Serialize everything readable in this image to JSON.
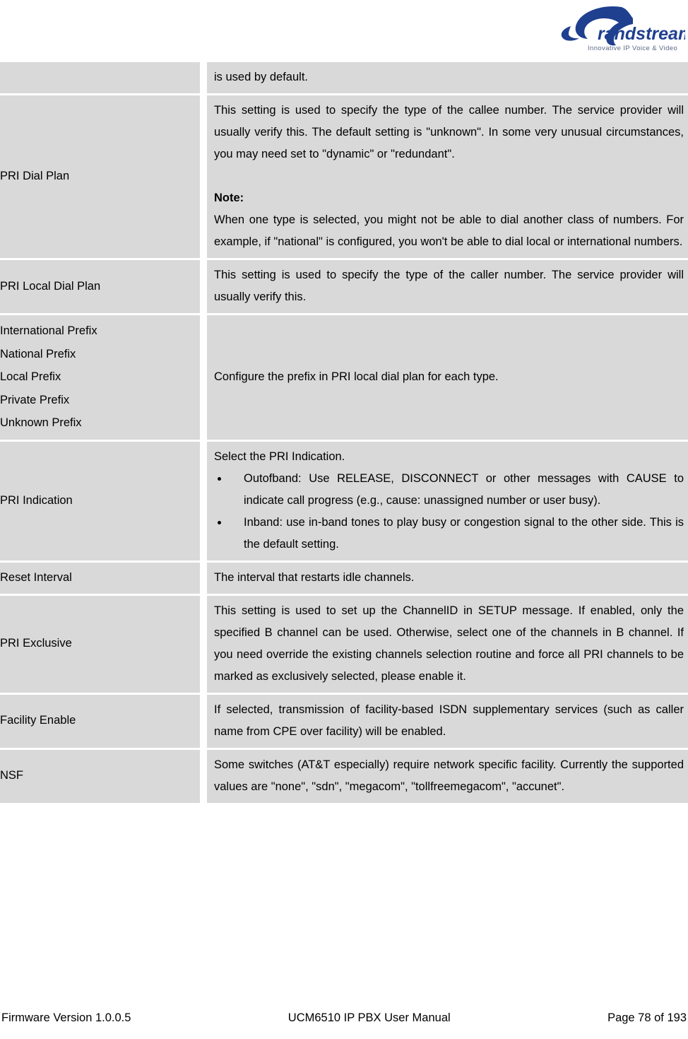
{
  "brand": {
    "logo_name": "grandstream-logo",
    "wordmark": "randstream",
    "tagline": "Innovative IP Voice & Video",
    "logo_color": "#1f3f8f"
  },
  "colors": {
    "cell_background": "#d9d9d9",
    "page_background": "#ffffff",
    "text": "#000000"
  },
  "table": {
    "rows": [
      {
        "label": "",
        "paragraphs": [
          {
            "type": "text",
            "text": "is used by default."
          }
        ]
      },
      {
        "label": "PRI Dial Plan",
        "paragraphs": [
          {
            "type": "text",
            "text": "This setting is used to specify the type of the callee number. The service provider will usually verify this. The default setting is \"unknown\". In some very unusual circumstances, you may need set to \"dynamic\" or \"redundant\"."
          },
          {
            "type": "blank",
            "text": ""
          },
          {
            "type": "note-head",
            "text": "Note:"
          },
          {
            "type": "text",
            "text": "When one type is selected, you might not be able to dial another class of numbers. For example, if \"national\" is configured, you won't be able to dial local or international numbers."
          }
        ]
      },
      {
        "label": "PRI Local Dial Plan",
        "paragraphs": [
          {
            "type": "text",
            "text": "This setting is used to specify the type of the caller number. The service provider will usually verify this."
          }
        ]
      },
      {
        "label_list": [
          "International Prefix",
          "National Prefix",
          "Local Prefix",
          "Private Prefix",
          "Unknown Prefix"
        ],
        "paragraphs": [
          {
            "type": "text-left",
            "text": "Configure the prefix in PRI local dial plan for each type."
          }
        ]
      },
      {
        "label": "PRI Indication",
        "paragraphs": [
          {
            "type": "text-left",
            "text": "Select the PRI Indication."
          },
          {
            "type": "bullets",
            "items": [
              "Outofband: Use RELEASE, DISCONNECT or other messages with CAUSE to indicate call progress (e.g., cause: unassigned number or user busy).",
              "Inband: use in-band tones to play busy or congestion signal to the other side. This is the default setting."
            ]
          }
        ]
      },
      {
        "label": "Reset Interval",
        "paragraphs": [
          {
            "type": "text-left",
            "text": "The interval that restarts idle channels."
          }
        ]
      },
      {
        "label": "PRI Exclusive",
        "paragraphs": [
          {
            "type": "text",
            "text": "This setting is used to set up the ChannelID in SETUP message. If enabled, only the specified B channel can be used. Otherwise, select one of the channels in B channel. If you need override the existing channels selection routine and force all PRI channels to be marked as exclusively selected, please enable it."
          }
        ]
      },
      {
        "label": "Facility Enable",
        "paragraphs": [
          {
            "type": "text",
            "text": "If selected, transmission of facility-based ISDN supplementary services (such as caller name from CPE over facility) will be enabled."
          }
        ]
      },
      {
        "label": "NSF",
        "paragraphs": [
          {
            "type": "text",
            "text": "Some switches (AT&T especially) require network specific facility. Currently the supported values are \"none\", \"sdn\", \"megacom\", \"tollfreemegacom\", \"accunet\"."
          }
        ]
      }
    ]
  },
  "footer": {
    "left": "Firmware Version 1.0.0.5",
    "center": "UCM6510 IP PBX User Manual",
    "right": "Page 78 of 193"
  }
}
